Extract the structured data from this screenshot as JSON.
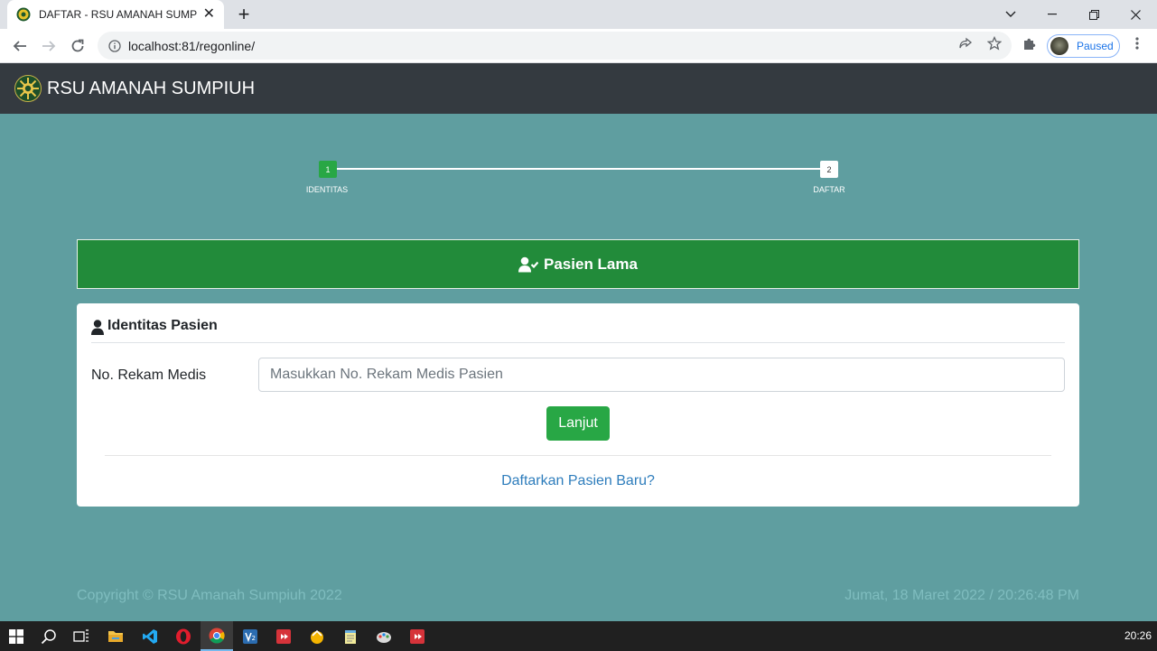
{
  "browser": {
    "tab_title": "DAFTAR - RSU AMANAH SUMPIUH",
    "url": "localhost:81/regonline/",
    "profile_status": "Paused"
  },
  "navbar": {
    "brand": "RSU AMANAH SUMPIUH"
  },
  "stepper": {
    "steps": [
      {
        "number": "1",
        "label": "IDENTITAS"
      },
      {
        "number": "2",
        "label": "DAFTAR"
      }
    ],
    "active_step": 1
  },
  "banner": {
    "title": "Pasien Lama"
  },
  "card": {
    "title": "Identitas Pasien",
    "field_label": "No. Rekam Medis",
    "field_placeholder": "Masukkan No. Rekam Medis Pasien",
    "field_value": "",
    "submit_label": "Lanjut",
    "register_link": "Daftarkan Pasien Baru?"
  },
  "footer": {
    "copyright": "Copyright © RSU Amanah Sumpiuh 2022",
    "datetime": "Jumat, 18 Maret 2022 / 20:26:48 PM"
  },
  "taskbar": {
    "apps": [
      "start-icon",
      "search-icon",
      "task-view-icon",
      "file-explorer-icon",
      "vscode-icon",
      "opera-icon",
      "chrome-icon",
      "app-v-icon",
      "app-red-icon",
      "app-yellow-icon",
      "notepad-icon",
      "app-paint-icon",
      "app-red2-icon"
    ],
    "clock": "20:26"
  },
  "colors": {
    "page_bg": "#5f9ea0",
    "navbar_bg": "#343a40",
    "banner_bg": "#228b3a",
    "button_green": "#28a745",
    "link_blue": "#2e7dbc"
  }
}
